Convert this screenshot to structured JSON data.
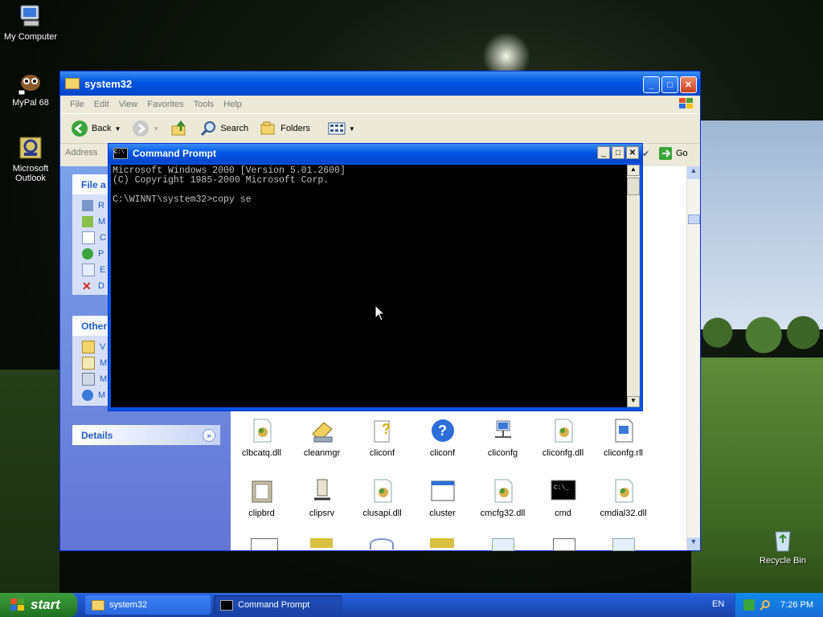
{
  "desktop": {
    "icons": [
      {
        "label": "My Computer",
        "icon": "my-computer-icon"
      },
      {
        "label": "MyPal 68",
        "icon": "mypal-icon"
      },
      {
        "label": "Microsoft Outlook",
        "icon": "outlook-icon"
      },
      {
        "label": "Recycle Bin",
        "icon": "recycle-bin-icon"
      }
    ]
  },
  "explorer": {
    "title": "system32",
    "menu": [
      "File",
      "Edit",
      "View",
      "Favorites",
      "Tools",
      "Help"
    ],
    "toolbar": {
      "back": "Back",
      "search": "Search",
      "folders": "Folders"
    },
    "address_label": "Address",
    "go_label": "Go",
    "panels": {
      "file_tasks": {
        "title": "File a",
        "items": [
          "R",
          "M",
          "C",
          "P",
          "E",
          "D"
        ]
      },
      "other_places": {
        "title": "Other",
        "items": [
          "V",
          "M",
          "M",
          "M"
        ]
      },
      "details": {
        "title": "Details"
      }
    },
    "files": [
      "clbcatq.dll",
      "cleanmgr",
      "cliconf",
      "cliconf",
      "cliconfg",
      "cliconfg.dll",
      "cliconfg.rll",
      "clipbrd",
      "clipsrv",
      "clusapi.dll",
      "cluster",
      "cmcfg32.dll",
      "cmd",
      "cmdial32.dll"
    ]
  },
  "cmd": {
    "title": "Command Prompt",
    "lines": [
      "Microsoft Windows 2000 [Version 5.01.2600]",
      "(C) Copyright 1985-2000 Microsoft Corp.",
      "",
      "C:\\WINNT\\system32>copy se"
    ]
  },
  "taskbar": {
    "start_label": "start",
    "tasks": [
      {
        "label": "system32"
      },
      {
        "label": "Command Prompt"
      }
    ],
    "lang": "EN",
    "clock": "7:26 PM"
  },
  "colors": {
    "xp_blue": "#0054e3",
    "start_green": "#2f8a2f",
    "console_bg": "#000000"
  }
}
